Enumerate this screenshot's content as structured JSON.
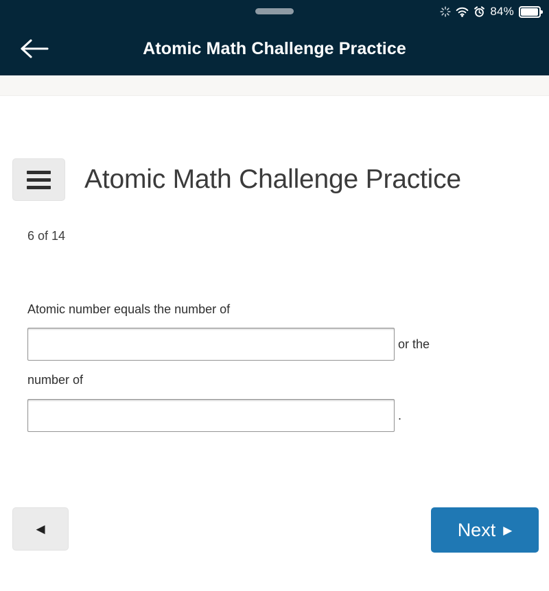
{
  "status_bar": {
    "sync_icon": "sync-spinner-icon",
    "wifi_icon": "wifi-icon",
    "alarm_icon": "alarm-clock-icon",
    "battery_percent": "84%",
    "battery_icon": "battery-icon"
  },
  "app_header": {
    "back_icon": "back-arrow-icon",
    "title": "Atomic Math Challenge Practice"
  },
  "page": {
    "menu_icon": "hamburger-menu-icon",
    "title": "Atomic Math Challenge Practice",
    "progress": "6 of 14"
  },
  "question": {
    "part1": "Atomic number equals the number of",
    "blank1_value": "",
    "blank1_placeholder": "",
    "part2": "or the",
    "part3": "number of",
    "blank2_value": "",
    "blank2_placeholder": "",
    "part4": "."
  },
  "navigation": {
    "prev_label": "◀",
    "next_label": "Next",
    "next_arrow": "▶"
  },
  "colors": {
    "header_bg": "#052639",
    "accent_blue": "#1f78b4",
    "button_gray": "#ebebeb",
    "strip_bg": "#f8f7f5"
  }
}
